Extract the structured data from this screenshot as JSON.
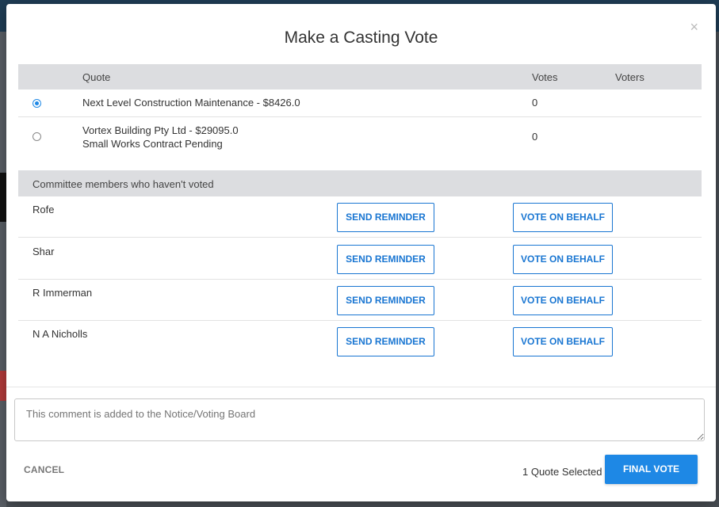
{
  "modal": {
    "title": "Make a Casting Vote",
    "close_icon": "×"
  },
  "quotes": {
    "headers": {
      "quote": "Quote",
      "votes": "Votes",
      "voters": "Voters"
    },
    "rows": [
      {
        "name": "Next Level Construction Maintenance - $8426.0",
        "note": "",
        "votes": "0",
        "selected": true
      },
      {
        "name": "Vortex Building Pty Ltd - $29095.0",
        "note": "Small Works Contract Pending",
        "votes": "0",
        "selected": false
      }
    ]
  },
  "committee": {
    "header": "Committee members who haven't voted",
    "remind_label": "SEND REMINDER",
    "behalf_label": "VOTE ON BEHALF",
    "members": [
      "Rofe",
      "Shar",
      "R Immerman",
      "N A Nicholls"
    ]
  },
  "comment": {
    "placeholder": "This comment is added to the Notice/Voting Board"
  },
  "footer": {
    "cancel_label": "CANCEL",
    "selected_text": "1 Quote Selected",
    "final_label": "FINAL VOTE"
  },
  "colors": {
    "accent": "#1e88e5",
    "header_bg": "#dcdde0"
  }
}
